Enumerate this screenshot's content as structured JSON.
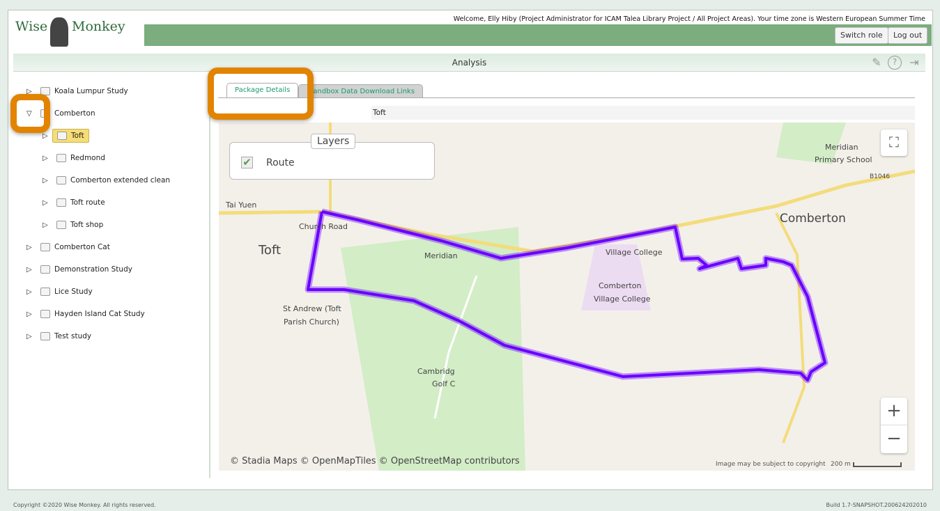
{
  "header": {
    "logo_left": "Wise",
    "logo_right": "Monkey",
    "welcome": "Welcome, Elly Hiby (Project Administrator for ICAM Talea Library Project / All Project Areas). Your time zone is Western European Summer Time",
    "switch_role": "Switch role",
    "log_out": "Log out"
  },
  "page": {
    "title": "Analysis",
    "icons": [
      "pencil-icon",
      "help-icon",
      "exit-icon"
    ]
  },
  "tree": [
    {
      "label": "Koala Lumpur Study",
      "level": 0,
      "expanded": false
    },
    {
      "label": "Comberton",
      "level": 0,
      "expanded": true
    },
    {
      "label": "Toft",
      "level": 1,
      "selected": true
    },
    {
      "label": "Redmond",
      "level": 1
    },
    {
      "label": "Comberton extended clean",
      "level": 1
    },
    {
      "label": "Toft route",
      "level": 1
    },
    {
      "label": "Toft shop",
      "level": 1
    },
    {
      "label": "Comberton Cat",
      "level": 0
    },
    {
      "label": "Demonstration Study",
      "level": 0
    },
    {
      "label": "Lice Study",
      "level": 0
    },
    {
      "label": "Hayden Island Cat Study",
      "level": 0
    },
    {
      "label": "Test study",
      "level": 0
    }
  ],
  "tabs": [
    {
      "label": "Package Details",
      "active": true
    },
    {
      "label": "Sandbox Data Download Links",
      "active": false
    }
  ],
  "details": {
    "value": "Toft"
  },
  "map": {
    "layers_title": "Layers",
    "layer_route": "Route",
    "route_checked": true,
    "route_color": "#6a00ff",
    "labels": {
      "toft": "Toft",
      "comberton": "Comberton",
      "church_road": "Church Road",
      "tai_yuen": "Tai Yuen",
      "st_andrew": "St Andrew (Toft",
      "parish": "Parish Church)",
      "meridian": "Meridian",
      "village_college": "Village College",
      "cvc1": "Comberton",
      "cvc2": "Village College",
      "mps1": "Meridian",
      "mps2": "Primary School",
      "b1046": "B1046",
      "golf1": "Cambridg",
      "golf2": "Golf C"
    },
    "attribution": "© Stadia Maps © OpenMapTiles © OpenStreetMap contributors",
    "copyright": "Image may be subject to copyright",
    "scale": "200 m",
    "zoom_in": "+",
    "zoom_out": "−"
  },
  "footer": {
    "copyright": "Copyright ©2020 Wise Monkey. All rights reserved.",
    "build": "Build 1.7-SNAPSHOT.200624202010"
  },
  "colors": {
    "accent": "#7bad7e",
    "highlight": "#e28400",
    "tab_text": "#1a9a6a",
    "selected": "#f6dd74"
  }
}
